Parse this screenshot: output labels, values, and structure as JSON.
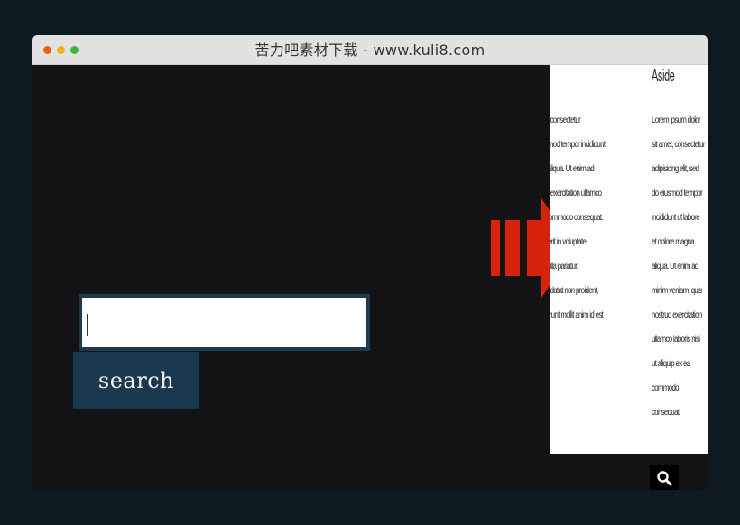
{
  "window": {
    "title": "苦力吧素材下载 - www.kuli8.com",
    "dots": {
      "red": "#f2600f",
      "yellow": "#e8b61c",
      "green": "#3ab83a"
    }
  },
  "search": {
    "button_label": "search",
    "input_value": "",
    "placeholder": ""
  },
  "preview": {
    "aside_heading": "Aside",
    "main_lines": [
      "or sit amet, consectetur",
      "ed do eiusmod tempor incididunt",
      "re magna aliqua. Ut enim ad",
      "uis nostrud exercitation ullamco",
      "uip ex ea commodo consequat.",
      "reprehenderit in voluptate",
      "eu fugiat nulla pariatur.",
      "caecat cupidatat non proident,",
      "officia deserunt mollit anim id est"
    ],
    "aside_lines": [
      "Lorem ipsum dolor",
      "sit amet, consectetur",
      "adipisicing elit, sed",
      "do eiusmod tempor",
      "incididunt ut labore",
      "et dolore magna",
      "aliqua. Ut enim ad",
      "minim veniam, quis",
      "nostrud exercitation",
      "ullamco laboris nisi",
      "ut aliquip ex ea",
      "commodo",
      "consequat."
    ]
  },
  "colors": {
    "page_bg": "#0e1a22",
    "content_bg": "#131215",
    "button_bg": "#1a384e",
    "arrow": "#d8220e"
  }
}
